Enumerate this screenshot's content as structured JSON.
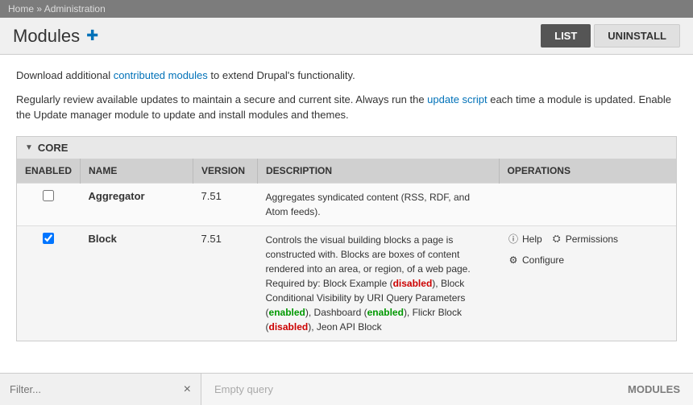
{
  "breadcrumb": {
    "home": "Home",
    "separator": "»",
    "admin": "Administration"
  },
  "header": {
    "title": "Modules",
    "tabs": [
      {
        "label": "LIST",
        "active": true
      },
      {
        "label": "UNINSTALL",
        "active": false
      }
    ]
  },
  "content": {
    "info1_before": "Download additional ",
    "info1_link": "contributed modules",
    "info1_after": " to extend Drupal's functionality.",
    "info2_before": "Regularly review available updates to maintain a secure and current site. Always run the ",
    "info2_link": "update script",
    "info2_after": " each time a module is updated. Enable the Update manager module to update and install modules and themes."
  },
  "section": {
    "label": "CORE",
    "columns": {
      "enabled": "ENABLED",
      "name": "NAME",
      "version": "VERSION",
      "description": "DESCRIPTION",
      "operations": "OPERATIONS"
    }
  },
  "modules": [
    {
      "id": "aggregator",
      "enabled": false,
      "name": "Aggregator",
      "version": "7.51",
      "description": "Aggregates syndicated content (RSS, RDF, and Atom feeds).",
      "operations": []
    },
    {
      "id": "block",
      "enabled": true,
      "name": "Block",
      "version": "7.51",
      "description": "Controls the visual building blocks a page is constructed with. Blocks are boxes of content rendered into an area, or region, of a web page.",
      "required_by_label": "Required by: Block Example (",
      "required_by_disabled": "disabled",
      "required_by_mid": "), Block Conditional Visibility by URI Query Parameters (",
      "required_by_enabled": "enabled",
      "required_by_end": "), Dashboard (",
      "required_by_enabled2": "enabled",
      "required_by_tail": "), Flickr Block (",
      "required_by_disabled2": "disabled",
      "required_by_more": "), Jeon API Block",
      "operations": [
        {
          "label": "Help",
          "icon": "help"
        },
        {
          "label": "Permissions",
          "icon": "permissions"
        },
        {
          "label": "Configure",
          "icon": "configure"
        }
      ]
    }
  ],
  "filter": {
    "label": "Filter...",
    "clear": "×",
    "placeholder": "Empty query",
    "modules_label": "MODULES"
  }
}
